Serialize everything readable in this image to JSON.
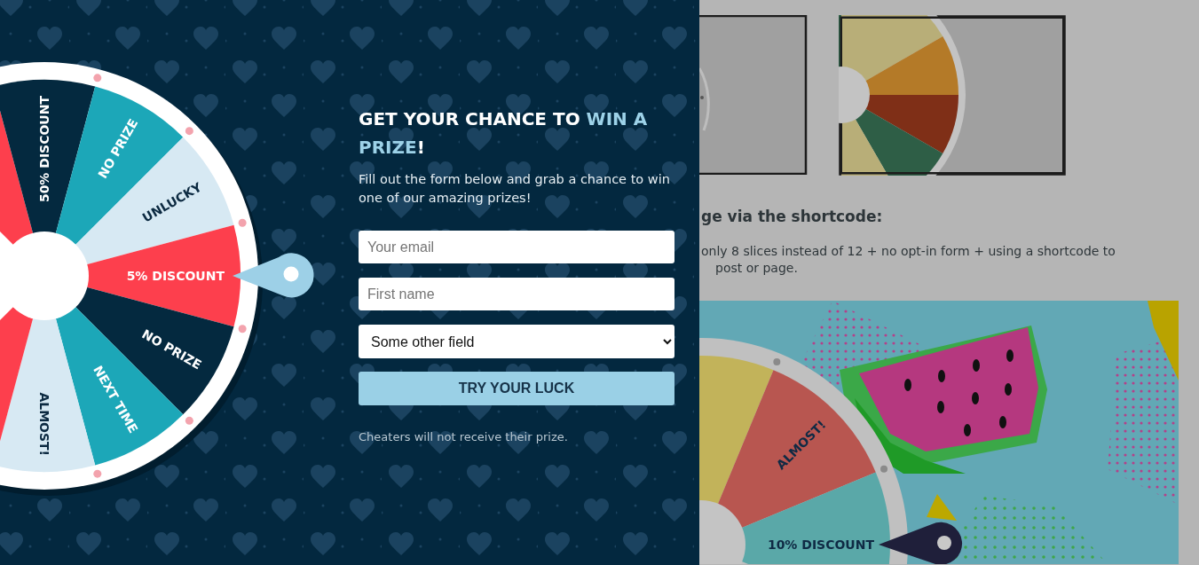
{
  "wheel": {
    "slices": [
      {
        "color": "#fd3f4d"
      },
      {
        "label": "50% DISCOUNT",
        "color": "#04293f"
      },
      {
        "label": "NO PRIZE",
        "color": "#1ca7b8"
      },
      {
        "label": "UNLUCKY",
        "color": "#d7e9f3"
      },
      {
        "label": "5% DISCOUNT",
        "color": "#fd3f4d"
      },
      {
        "label": "NO PRIZE",
        "color": "#04293f"
      },
      {
        "label": "NEXT TIME",
        "color": "#1ca7b8"
      },
      {
        "label": "ALMOST!",
        "color": "#d7e9f3"
      },
      {
        "color": "#fd3f4d"
      }
    ]
  },
  "form": {
    "title": "GET YOUR CHANCE TO **WIN A PRIZE**!",
    "subtitle": "Fill out the form below and grab a chance to win one of our amazing prizes!",
    "fields": [
      {
        "kind": "input",
        "placeholder": "Your email"
      },
      {
        "kind": "input",
        "placeholder": "First name"
      },
      {
        "kind": "select",
        "value": "Some other field"
      }
    ],
    "button": "TRY YOUR LUCK",
    "note": "Cheaters will not receive their prize."
  },
  "background_page": {
    "heading": "ge via the shortcode:",
    "paragraph_lines": [
      "only 8 slices instead of 12 + no opt-in form + using a shortcode to",
      "post or page."
    ],
    "demo_wheel": {
      "slices": [
        {
          "color": "#c2b35a"
        },
        {
          "label": "ALMOST!",
          "color": "#b85650"
        },
        {
          "label": "10% DISCOUNT",
          "color": "#5aa8a8"
        }
      ]
    }
  }
}
